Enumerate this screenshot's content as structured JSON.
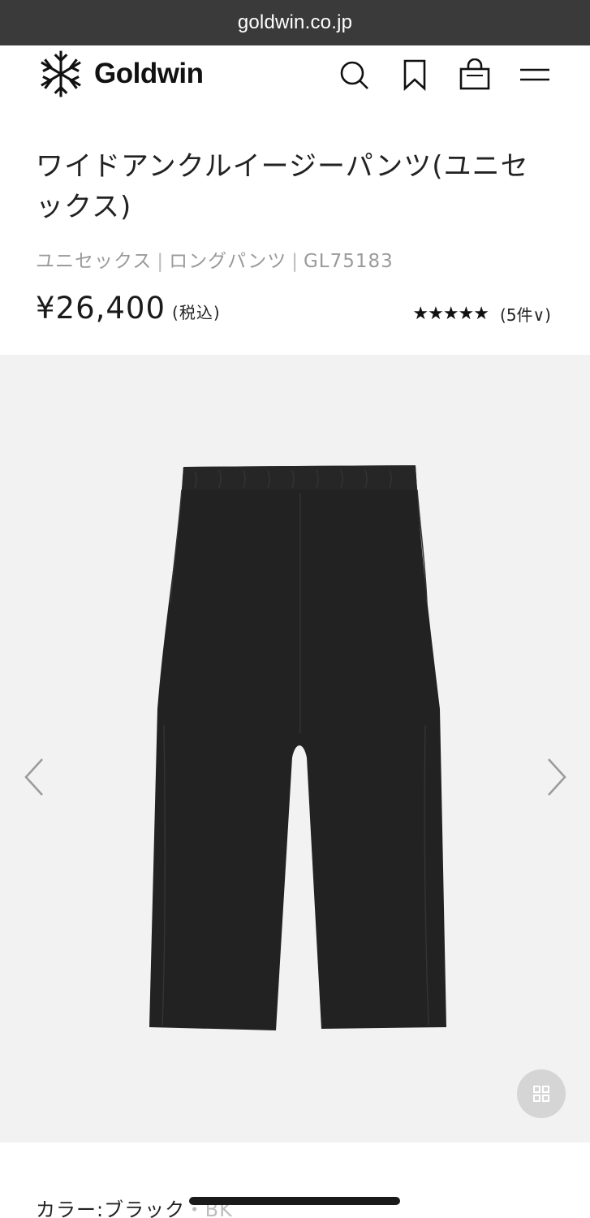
{
  "browser": {
    "url": "goldwin.co.jp"
  },
  "header": {
    "logo_text": "Goldwin",
    "icons": [
      "search-icon",
      "bookmark-icon",
      "cart-icon",
      "menu-icon"
    ]
  },
  "product": {
    "title": "ワイドアンクルイージーパンツ(ユニセックス)",
    "category": "ユニセックス",
    "subcategory": "ロングパンツ",
    "code": "GL75183",
    "separator": "|",
    "price": "¥26,400",
    "tax_note": "(税込)",
    "stars": "★★★★★",
    "rating_value": 5,
    "review_count": "(5件",
    "review_caret": "∨)"
  },
  "gallery": {
    "prev_icon": "chevron-left-icon",
    "next_icon": "chevron-right-icon",
    "grid_icon": "grid-icon"
  },
  "color": {
    "label": "カラー:ブラック",
    "code": "・BK"
  },
  "colors": {
    "urlbar_bg": "#3a3a3a",
    "gallery_bg": "#f2f2f2",
    "product_color": "#222222"
  }
}
